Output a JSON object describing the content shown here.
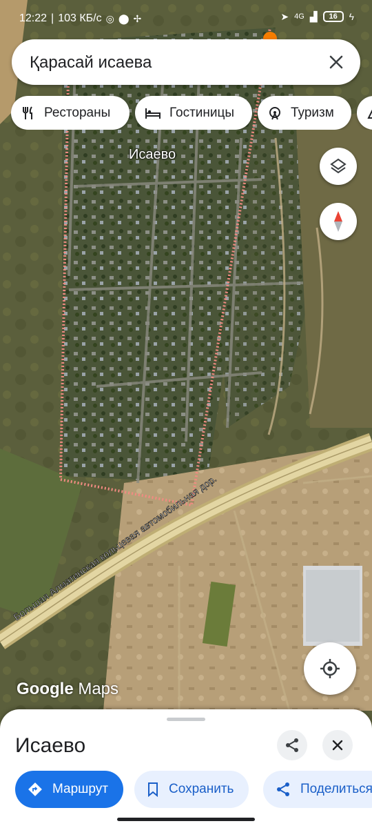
{
  "status_bar": {
    "time": "12:22",
    "speed": "103 КБ/с",
    "network": "4G",
    "battery": "16"
  },
  "search": {
    "query": "Қарасай исаева",
    "close_icon": "close-icon"
  },
  "chips": [
    {
      "label": "Рестораны",
      "icon": "restaurant-icon"
    },
    {
      "label": "Гостиницы",
      "icon": "hotel-icon"
    },
    {
      "label": "Туризм",
      "icon": "attraction-icon"
    }
  ],
  "map": {
    "place_label": "Исаево",
    "road_label": "Большая Алматинская кольцевая автомобильная дор.",
    "watermark_brand": "Google",
    "watermark_product": "Maps",
    "boundary_color": "#f28b82",
    "highway_color": "#d7c78a"
  },
  "sheet": {
    "title": "Исаево",
    "share_icon": "share-icon",
    "close_icon": "close-icon",
    "actions": [
      {
        "label": "Маршрут",
        "icon": "directions-icon"
      },
      {
        "label": "Сохранить",
        "icon": "bookmark-icon"
      },
      {
        "label": "Поделиться",
        "icon": "share-icon"
      }
    ]
  },
  "colors": {
    "accent": "#1a73e8",
    "accent_light": "#e8f0fe"
  }
}
